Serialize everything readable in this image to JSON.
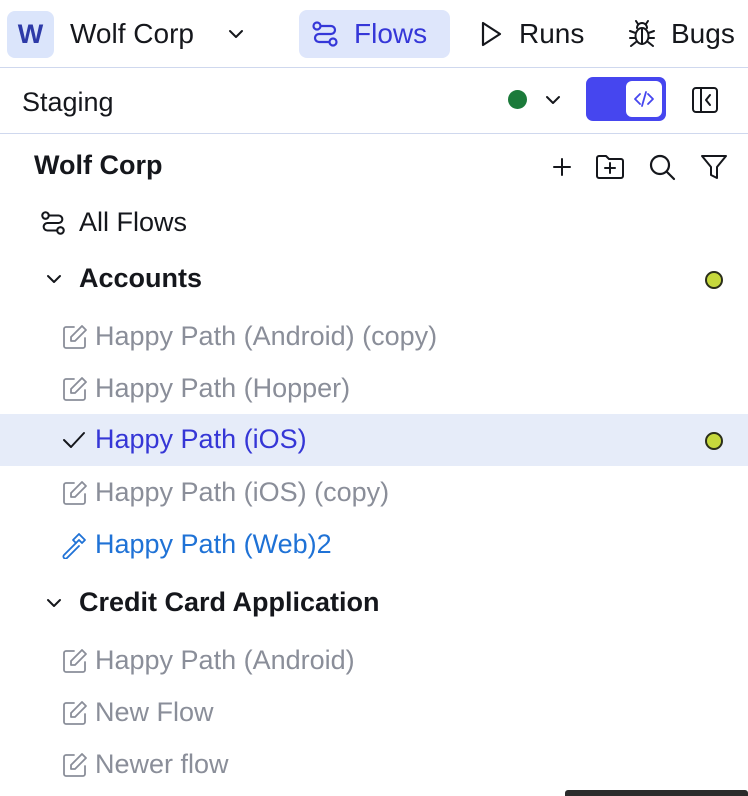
{
  "workspace": {
    "initial": "W",
    "name": "Wolf Corp"
  },
  "nav": {
    "flows": "Flows",
    "runs": "Runs",
    "bugs": "Bugs"
  },
  "environment": {
    "name": "Staging",
    "status_color": "#1b7a3a"
  },
  "tree": {
    "title": "Wolf Corp",
    "all_flows": "All Flows",
    "folders": [
      {
        "name": "Accounts",
        "expanded": true,
        "status": "lime",
        "flows": [
          {
            "name": "Happy Path (Android) (copy)",
            "icon": "edit-icon"
          },
          {
            "name": "Happy Path (Hopper)",
            "icon": "edit-icon"
          },
          {
            "name": "Happy Path (iOS)",
            "icon": "check-icon",
            "selected": true,
            "status": "lime"
          },
          {
            "name": "Happy Path (iOS) (copy)",
            "icon": "edit-icon"
          },
          {
            "name": "Happy Path (Web)2",
            "icon": "hammer-icon"
          }
        ]
      },
      {
        "name": "Credit Card Application",
        "expanded": true,
        "flows": [
          {
            "name": "Happy Path (Android)",
            "icon": "edit-icon"
          },
          {
            "name": "New Flow",
            "icon": "edit-icon"
          },
          {
            "name": "Newer flow",
            "icon": "edit-icon"
          }
        ]
      }
    ]
  },
  "colors": {
    "accent": "#3537d8",
    "status_lime": "#c6d93c",
    "web_flow": "#1f72d6",
    "muted": "#8a8e99"
  }
}
